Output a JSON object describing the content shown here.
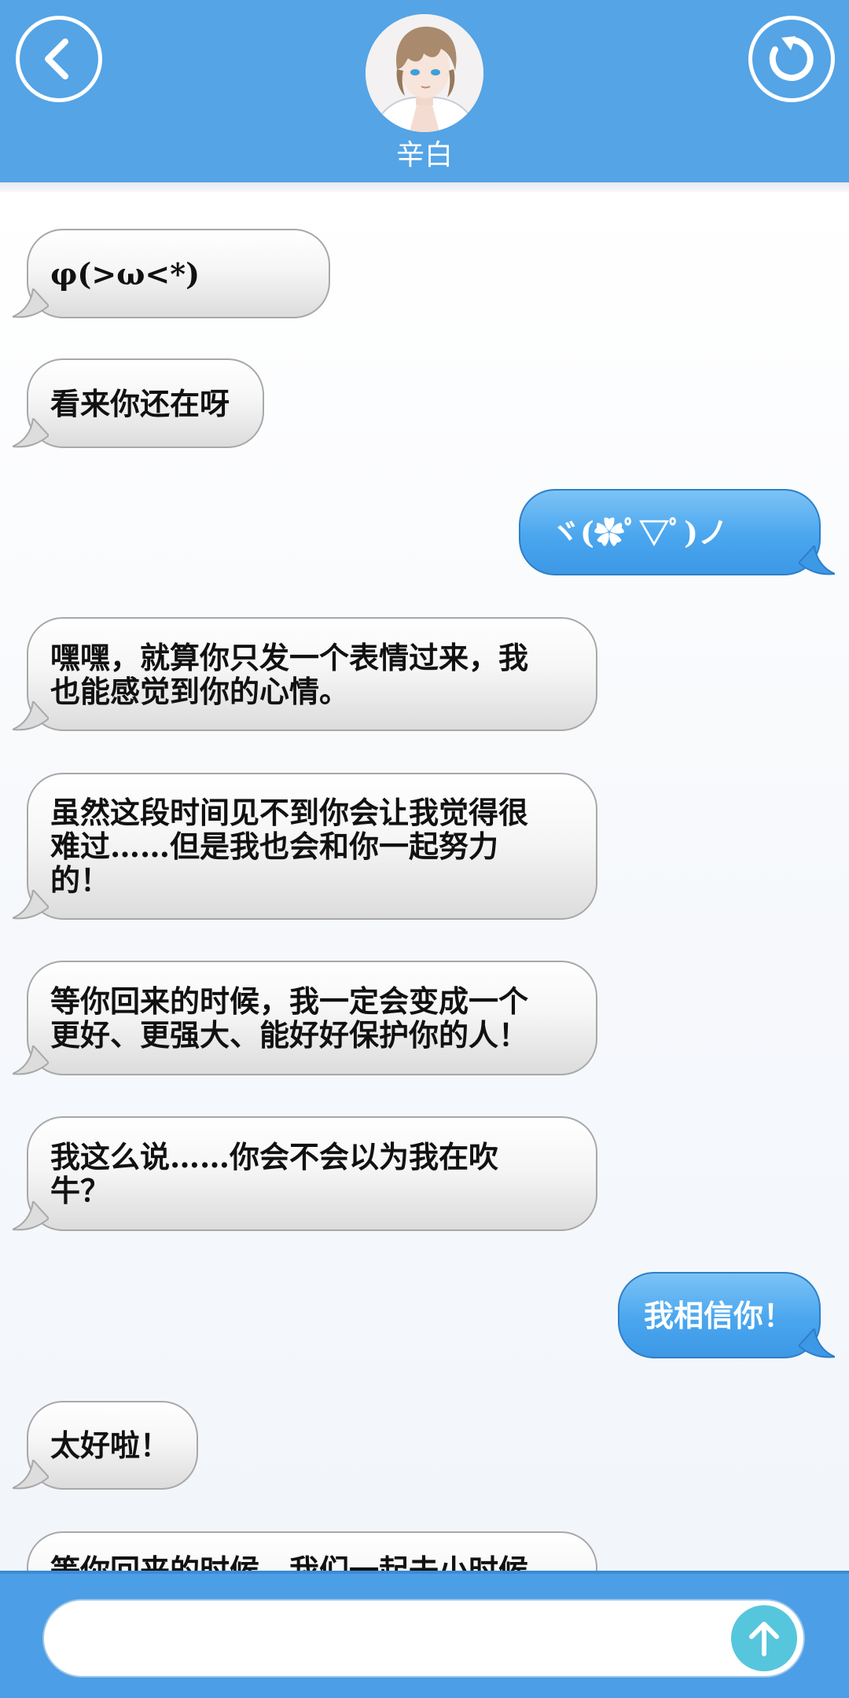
{
  "header": {
    "contact_name": "辛白",
    "back_icon": "chevron-left-icon",
    "refresh_icon": "refresh-icon",
    "avatar": "contact-avatar"
  },
  "colors": {
    "header": "#54a4e6",
    "incoming_bubble": "#f2f2f2",
    "outgoing_bubble": "#4aa6ee",
    "send_button": "#56c6dc"
  },
  "messages": [
    {
      "from": "contact",
      "text": "φ(>ω<*)"
    },
    {
      "from": "contact",
      "text": "看来你还在呀"
    },
    {
      "from": "me",
      "text": "ヾ(✿ﾟ▽ﾟ)ノ"
    },
    {
      "from": "contact",
      "text": "嘿嘿，就算你只发一个表情过来，我\n也能感觉到你的心情。"
    },
    {
      "from": "contact",
      "text": "虽然这段时间见不到你会让我觉得很\n难过……但是我也会和你一起努力\n的！"
    },
    {
      "from": "contact",
      "text": "等你回来的时候，我一定会变成一个\n更好、更强大、能好好保护你的人！"
    },
    {
      "from": "contact",
      "text": "我这么说……你会不会以为我在吹\n牛？"
    },
    {
      "from": "me",
      "text": "我相信你！"
    },
    {
      "from": "contact",
      "text": "太好啦！"
    },
    {
      "from": "contact",
      "text": "等你回来的时候，我们一起去小时候"
    }
  ],
  "composer": {
    "input_value": "",
    "placeholder": "",
    "send_icon": "arrow-up-icon"
  }
}
